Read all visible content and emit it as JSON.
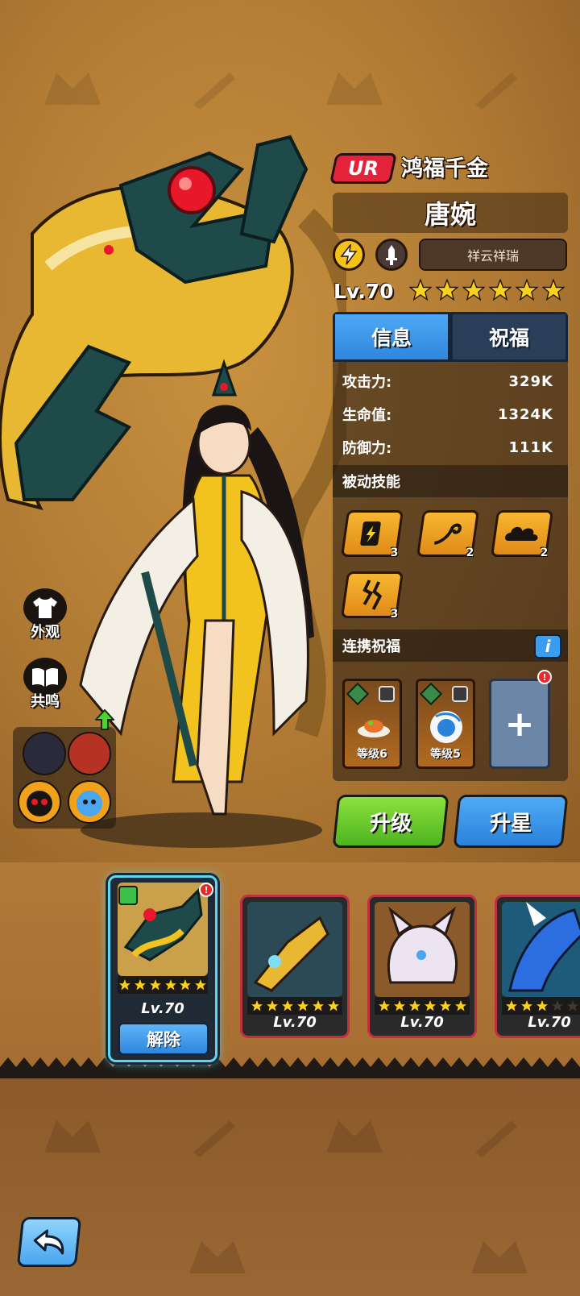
{
  "hero": {
    "rarity": "UR",
    "title": "鸿福千金",
    "name": "唐婉",
    "trait": "祥云祥瑞",
    "level": "Lv.70",
    "stars": 6
  },
  "tabs": {
    "info": "信息",
    "blessing": "祝福"
  },
  "stats": [
    {
      "label": "攻击力:",
      "value": "329K"
    },
    {
      "label": "生命值:",
      "value": "1324K"
    },
    {
      "label": "防御力:",
      "value": "111K"
    }
  ],
  "passive": {
    "title": "被动技能",
    "skills": [
      {
        "icon": "card-lightning-icon",
        "count": "3"
      },
      {
        "icon": "swirl-icon",
        "count": "2"
      },
      {
        "icon": "cloud-icon",
        "count": "2"
      },
      {
        "icon": "crack-icon",
        "count": "3"
      }
    ]
  },
  "bond": {
    "title": "连携祝福",
    "info_label": "i",
    "cards": [
      {
        "label": "等级6",
        "icon": "food-plate-icon"
      },
      {
        "label": "等级5",
        "icon": "ice-orb-icon"
      }
    ],
    "add_label": "+",
    "alert": "!"
  },
  "actions": {
    "upgrade": "升级",
    "star_up": "升星"
  },
  "side": {
    "appearance": "外观",
    "resonance": "共鸣"
  },
  "roster": [
    {
      "level": "Lv.70",
      "stars": 6,
      "selected": true,
      "release": "解除",
      "alert": "!"
    },
    {
      "level": "Lv.70",
      "stars": 6
    },
    {
      "level": "Lv.70",
      "stars": 6
    },
    {
      "level": "Lv.70",
      "stars": 3
    }
  ],
  "colors": {
    "background": "#b07a34",
    "ur_red": "#e2233a",
    "tab_active": "#3a9ef0",
    "upgrade_green": "#6bcf2e",
    "star_blue": "#3a98ee",
    "gold_star": "#f7d21e"
  }
}
